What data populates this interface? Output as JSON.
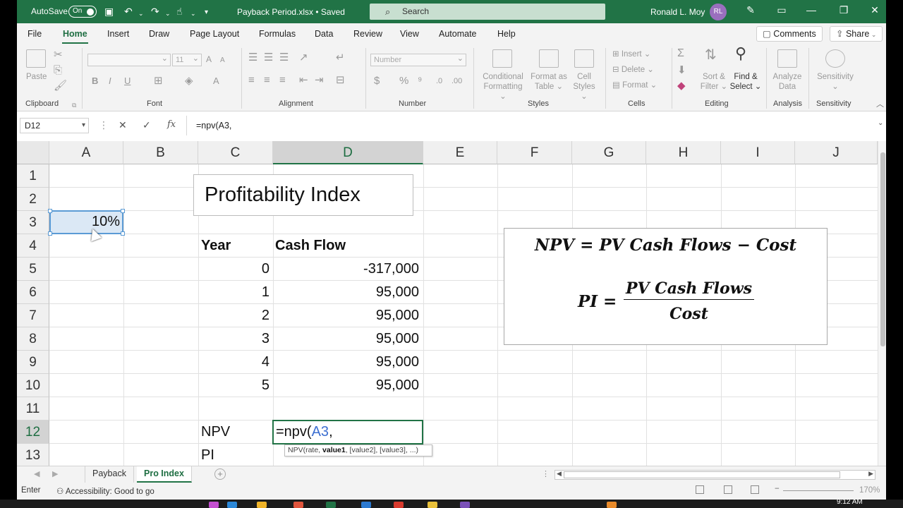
{
  "titlebar": {
    "autosave_label": "AutoSave",
    "autosave_state": "On",
    "filename": "Payback Period.xlsx • Saved",
    "search_placeholder": "Search",
    "user_name": "Ronald L. Moy",
    "user_initials": "RL"
  },
  "menu": {
    "tabs": [
      "File",
      "Home",
      "Insert",
      "Draw",
      "Page Layout",
      "Formulas",
      "Data",
      "Review",
      "View",
      "Automate",
      "Help"
    ],
    "active": "Home",
    "comments": "Comments",
    "share": "Share"
  },
  "ribbon": {
    "clipboard": {
      "label": "Clipboard",
      "paste": "Paste"
    },
    "font": {
      "label": "Font",
      "size": "11"
    },
    "alignment": {
      "label": "Alignment"
    },
    "number": {
      "label": "Number",
      "format": "Number"
    },
    "styles": {
      "label": "Styles",
      "conditional": "Conditional",
      "formatting": "Formatting",
      "format_as": "Format as",
      "table": "Table",
      "cell": "Cell",
      "cell_styles": "Styles"
    },
    "cells": {
      "label": "Cells",
      "insert": "Insert",
      "delete": "Delete",
      "format": "Format"
    },
    "editing": {
      "label": "Editing",
      "sort": "Sort &",
      "filter": "Filter",
      "find": "Find &",
      "select": "Select"
    },
    "analysis": {
      "label": "Analysis",
      "analyze": "Analyze",
      "data": "Data"
    },
    "sensitivity": {
      "label": "Sensitivity",
      "btn": "Sensitivity"
    }
  },
  "formula_bar": {
    "name_box": "D12",
    "formula": "=npv(A3,"
  },
  "grid": {
    "columns": [
      "A",
      "B",
      "C",
      "D",
      "E",
      "F",
      "G",
      "H",
      "I",
      "J"
    ],
    "rows": [
      "1",
      "2",
      "3",
      "4",
      "5",
      "6",
      "7",
      "8",
      "9",
      "10",
      "11",
      "12",
      "13"
    ],
    "a3": "10%",
    "title_box": "Profitability Index",
    "year_header": "Year",
    "cash_header": "Cash Flow",
    "years": [
      "0",
      "1",
      "2",
      "3",
      "4",
      "5"
    ],
    "cash_flows": [
      "-317,000",
      "95,000",
      "95,000",
      "95,000",
      "95,000",
      "95,000"
    ],
    "npv_label": "NPV",
    "pi_label": "PI",
    "edit_prefix": "=npv(",
    "edit_ref": "A3",
    "edit_suffix": ",",
    "tooltip_fn": "NPV(rate, ",
    "tooltip_bold": "value1",
    "tooltip_rest": ", [value2], [value3], ...)"
  },
  "formula_box": {
    "line1": "NPV = PV Cash Flows  − Cost",
    "pi_lhs": "PI =",
    "numerator": "PV Cash Flows",
    "denominator": "Cost"
  },
  "sheets": {
    "tabs": [
      "Payback",
      "Pro Index"
    ],
    "active": "Pro Index"
  },
  "status": {
    "mode": "Enter",
    "accessibility": "Accessibility: Good to go",
    "zoom": "170%"
  },
  "taskbar": {
    "time": "9:12 AM"
  },
  "colors": {
    "excel_green": "#217346",
    "selection_blue": "#5b9bd5",
    "ref_blue": "#3c6fd1"
  }
}
